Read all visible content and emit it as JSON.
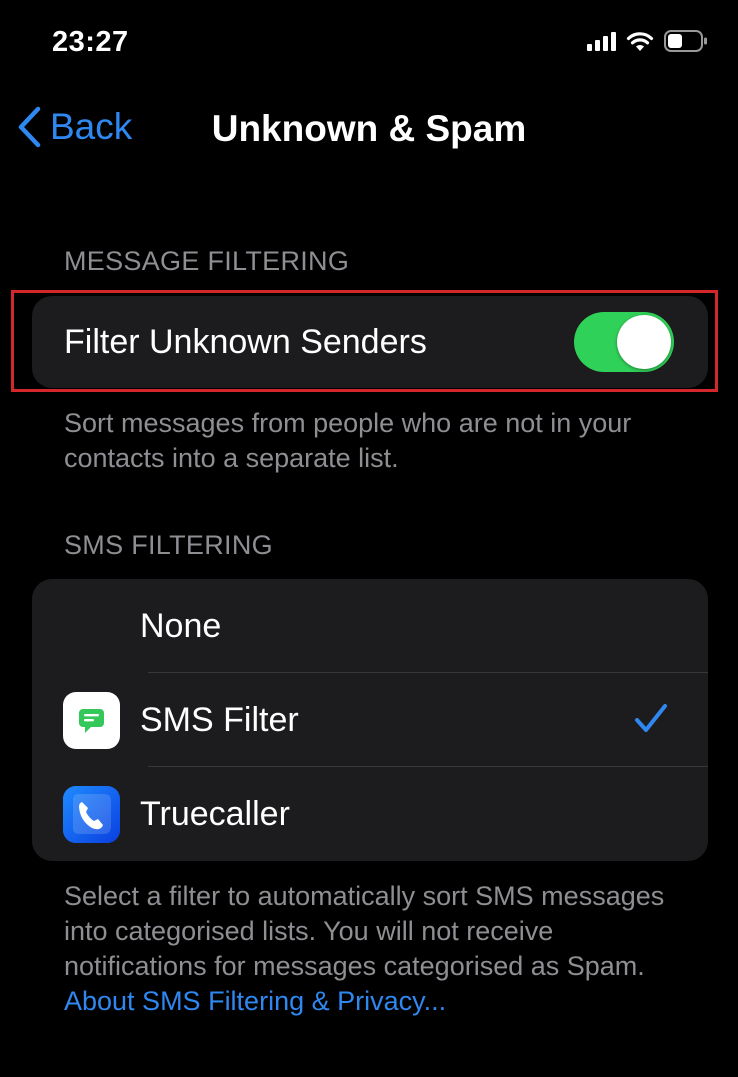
{
  "status_bar": {
    "time": "23:27",
    "signal_icon": "cellular-signal-icon",
    "wifi_icon": "wifi-icon",
    "battery_icon": "battery-icon"
  },
  "nav": {
    "back_label": "Back",
    "title": "Unknown & Spam"
  },
  "message_filtering": {
    "header": "MESSAGE FILTERING",
    "filter_unknown_label": "Filter Unknown Senders",
    "filter_unknown_on": true,
    "footer": "Sort messages from people who are not in your contacts into a separate list."
  },
  "sms_filtering": {
    "header": "SMS FILTERING",
    "options": [
      {
        "label": "None",
        "icon": "",
        "selected": false
      },
      {
        "label": "SMS Filter",
        "icon": "sms-filter-app-icon",
        "selected": true
      },
      {
        "label": "Truecaller",
        "icon": "truecaller-app-icon",
        "selected": false
      }
    ],
    "footer": "Select a filter to automatically sort SMS messages into categorised lists. You will not receive notifications for messages categorised as Spam.",
    "link": "About SMS Filtering & Privacy..."
  },
  "colors": {
    "accent": "#2f87f0",
    "toggle_on": "#30d158",
    "highlight": "#d3272c"
  }
}
